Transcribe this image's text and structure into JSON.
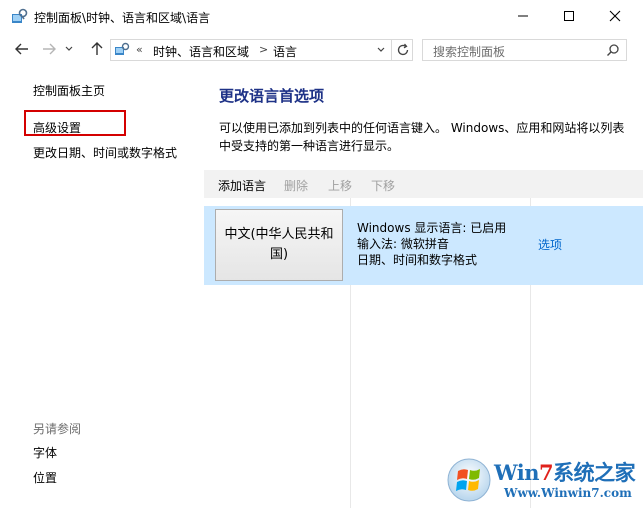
{
  "window": {
    "title": "控制面板\\时钟、语言和区域\\语言",
    "app_icon": "control-panel-icon",
    "controls": [
      "minimize-icon",
      "maximize-icon",
      "close-icon"
    ]
  },
  "nav": {
    "back_icon": "arrow-left-icon",
    "forward_icon": "arrow-right-icon",
    "up_icon": "arrow-up-icon",
    "separator": "«",
    "crumb_sep": ">",
    "breadcrumbs": [
      "时钟、语言和区域",
      "语言"
    ],
    "search_placeholder": "搜索控制面板"
  },
  "sidebar": {
    "home": "控制面板主页",
    "advanced": "高级设置",
    "date_format": "更改日期、时间或数字格式",
    "see_also": "另请参阅",
    "fonts": "字体",
    "location": "位置"
  },
  "main": {
    "title": "更改语言首选项",
    "description": "可以使用已添加到列表中的任何语言键入。 Windows、应用和网站将以列表中受支持的第一种语言进行显示。",
    "toolbar": {
      "add": "添加语言",
      "remove": "删除",
      "move_up": "上移",
      "move_down": "下移"
    },
    "languages": [
      {
        "name": "中文(中华人民共和国)",
        "details": [
          "Windows 显示语言: 已启用",
          "输入法: 微软拼音",
          "日期、时间和数字格式"
        ],
        "options": "选项"
      }
    ]
  },
  "watermark": {
    "brand_a": "Win",
    "brand_b": "7",
    "brand_c": "系统之家",
    "url": "Www.Winwin7.com"
  },
  "colors": {
    "accent_title": "#1e3287",
    "link": "#0066cc",
    "selection": "#cce8ff",
    "highlight_box": "#d40000"
  }
}
